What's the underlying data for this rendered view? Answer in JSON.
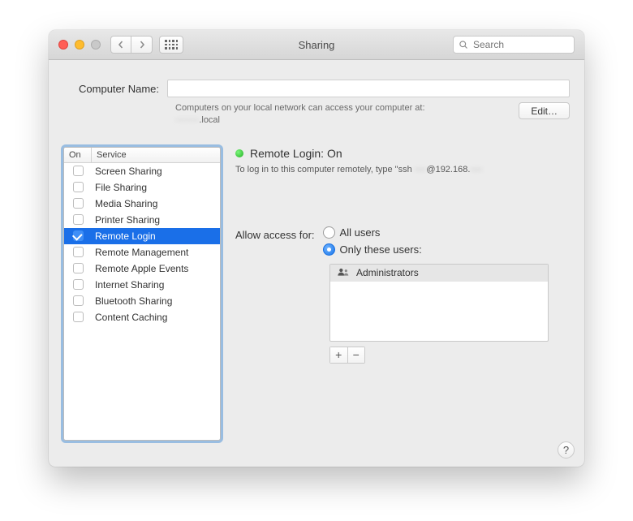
{
  "window": {
    "title": "Sharing",
    "search_placeholder": "Search"
  },
  "computer_name": {
    "label": "Computer Name:",
    "value": "",
    "hint_line1": "Computers on your local network can access your computer at:",
    "hint_local_redacted": "········",
    "hint_suffix": ".local",
    "edit_label": "Edit…"
  },
  "services": {
    "header_on": "On",
    "header_service": "Service",
    "items": [
      {
        "label": "Screen Sharing",
        "checked": false,
        "selected": false
      },
      {
        "label": "File Sharing",
        "checked": false,
        "selected": false
      },
      {
        "label": "Media Sharing",
        "checked": false,
        "selected": false
      },
      {
        "label": "Printer Sharing",
        "checked": false,
        "selected": false
      },
      {
        "label": "Remote Login",
        "checked": true,
        "selected": true
      },
      {
        "label": "Remote Management",
        "checked": false,
        "selected": false
      },
      {
        "label": "Remote Apple Events",
        "checked": false,
        "selected": false
      },
      {
        "label": "Internet Sharing",
        "checked": false,
        "selected": false
      },
      {
        "label": "Bluetooth Sharing",
        "checked": false,
        "selected": false
      },
      {
        "label": "Content Caching",
        "checked": false,
        "selected": false
      }
    ]
  },
  "detail": {
    "status_label": "Remote Login: On",
    "ssh_prefix": "To log in to this computer remotely, type \"ssh ",
    "ssh_user_redacted": "····",
    "ssh_mid": "@192.168.",
    "ssh_tail_redacted": "····",
    "access_label": "Allow access for:",
    "radio_all": "All users",
    "radio_only": "Only these users:",
    "radio_selected": "only",
    "users": [
      "Administrators"
    ],
    "add_label": "+",
    "remove_label": "−"
  },
  "help_label": "?"
}
